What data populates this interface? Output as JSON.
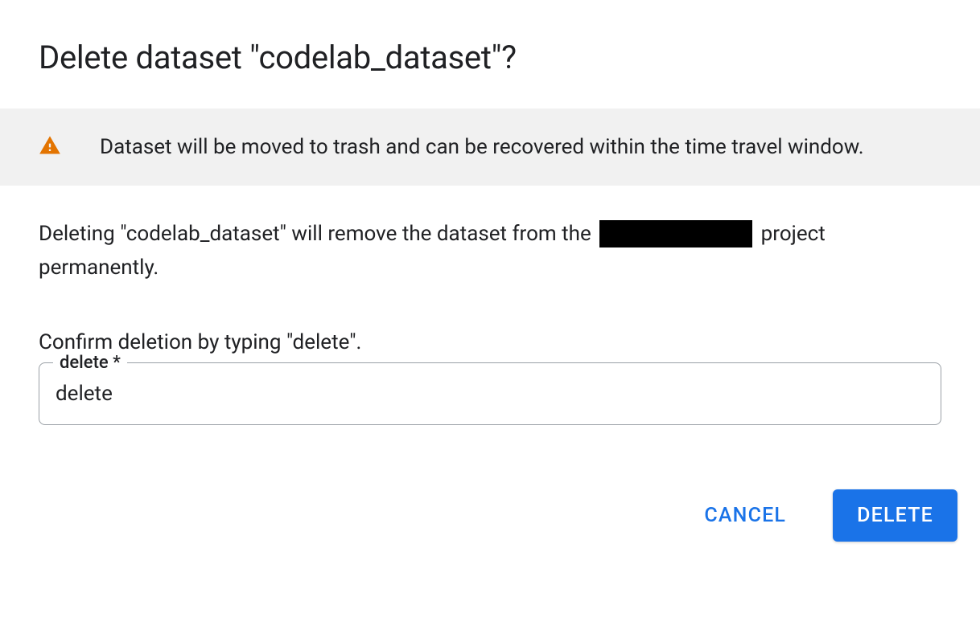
{
  "dialog": {
    "title": "Delete dataset \"codelab_dataset\"?",
    "banner_text": "Dataset will be moved to trash and can be recovered within the time travel window.",
    "description_prefix": "Deleting \"codelab_dataset\" will remove the dataset from the ",
    "description_suffix": " project permanently.",
    "confirm_prompt": "Confirm deletion by typing \"delete\".",
    "input_label": "delete *",
    "input_value": "delete",
    "cancel_label": "CANCEL",
    "delete_label": "DELETE"
  },
  "colors": {
    "warning": "#e37400",
    "primary": "#1a73e8"
  }
}
